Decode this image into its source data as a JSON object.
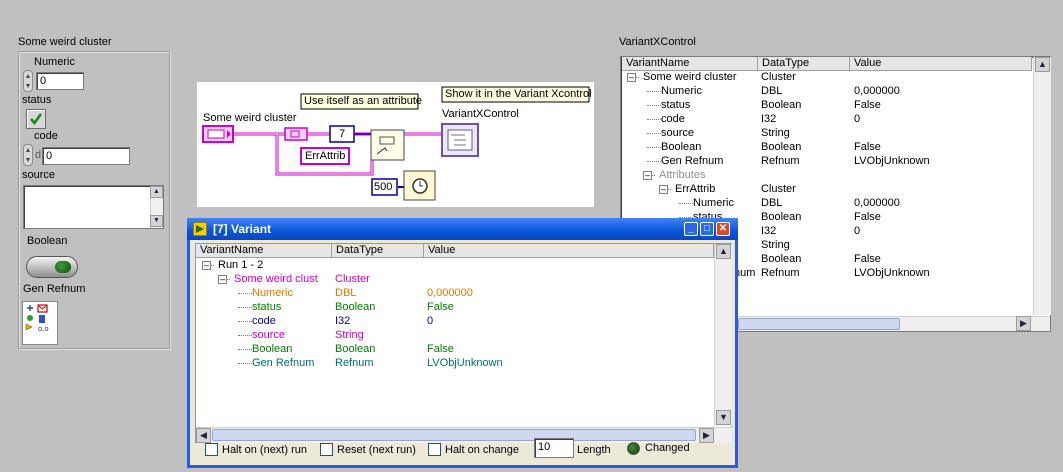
{
  "front_panel": {
    "cluster_label": "Some weird cluster",
    "numeric_label": "Numeric",
    "numeric_value": "0",
    "status_label": "status",
    "code_label": "code",
    "code_prefix": "d",
    "code_value": "0",
    "source_label": "source",
    "source_value": "",
    "boolean_label": "Boolean",
    "refnum_label": "Gen Refnum"
  },
  "block_diagram": {
    "cluster_terminal_label": "Some weird cluster",
    "attr_comment": "Use itself as an attribute",
    "show_comment": "Show it in the Variant Xcontrol",
    "xcontrol_label": "VariantXControl",
    "constant_7": "7",
    "err_attrib": "ErrAttrib",
    "constant_500": "500"
  },
  "variant_xcontrol": {
    "label": "VariantXControl",
    "columns": [
      "VariantName",
      "DataType",
      "Value"
    ],
    "rows": [
      {
        "indent": 0,
        "toggle": "-",
        "name": "Some weird cluster",
        "type": "Cluster",
        "value": ""
      },
      {
        "indent": 1,
        "toggle": "",
        "name": "Numeric",
        "type": "DBL",
        "value": "0,000000"
      },
      {
        "indent": 1,
        "toggle": "",
        "name": "status",
        "type": "Boolean",
        "value": "False"
      },
      {
        "indent": 1,
        "toggle": "",
        "name": "code",
        "type": "I32",
        "value": "0"
      },
      {
        "indent": 1,
        "toggle": "",
        "name": "source",
        "type": "String",
        "value": ""
      },
      {
        "indent": 1,
        "toggle": "",
        "name": "Boolean",
        "type": "Boolean",
        "value": "False"
      },
      {
        "indent": 1,
        "toggle": "",
        "name": "Gen Refnum",
        "type": "Refnum",
        "value": "LVObjUnknown"
      },
      {
        "indent": 1,
        "toggle": "-",
        "name": "Attributes",
        "type": "",
        "value": "",
        "muted": true
      },
      {
        "indent": 2,
        "toggle": "-",
        "name": "ErrAttrib",
        "type": "Cluster",
        "value": ""
      },
      {
        "indent": 3,
        "toggle": "",
        "name": "Numeric",
        "type": "DBL",
        "value": "0,000000"
      },
      {
        "indent": 3,
        "toggle": "",
        "name": "status",
        "type": "Boolean",
        "value": "False"
      },
      {
        "indent": 3,
        "toggle": "",
        "name": "code",
        "type": "I32",
        "value": "0"
      },
      {
        "indent": 3,
        "toggle": "",
        "name": "source",
        "type": "String",
        "value": ""
      },
      {
        "indent": 3,
        "toggle": "",
        "name": "Boolean",
        "type": "Boolean",
        "value": "False"
      },
      {
        "indent": 3,
        "toggle": "",
        "name": "Gen Refnum",
        "type": "Refnum",
        "value": "LVObjUnknown"
      }
    ]
  },
  "variant_window": {
    "title": "[7] Variant",
    "columns": [
      "VariantName",
      "DataType",
      "Value"
    ],
    "rows": [
      {
        "indent": 0,
        "toggle": "-",
        "name": "Run 1 - 2",
        "type": "",
        "value": "",
        "color": "#000000"
      },
      {
        "indent": 1,
        "toggle": "-",
        "name": "Some weird clust",
        "type": "Cluster",
        "value": "",
        "color": "#cc00cc"
      },
      {
        "indent": 2,
        "toggle": "",
        "name": "Numeric",
        "type": "DBL",
        "value": "0,000000",
        "color": "#e07800"
      },
      {
        "indent": 2,
        "toggle": "",
        "name": "status",
        "type": "Boolean",
        "value": "False",
        "color": "#008000"
      },
      {
        "indent": 2,
        "toggle": "",
        "name": "code",
        "type": "I32",
        "value": "0",
        "color": "#0000a0"
      },
      {
        "indent": 2,
        "toggle": "",
        "name": "source",
        "type": "String",
        "value": "",
        "color": "#cc00cc"
      },
      {
        "indent": 2,
        "toggle": "",
        "name": "Boolean",
        "type": "Boolean",
        "value": "False",
        "color": "#008000"
      },
      {
        "indent": 2,
        "toggle": "",
        "name": "Gen Refnum",
        "type": "Refnum",
        "value": "LVObjUnknown",
        "color": "#007070"
      }
    ],
    "halt_next_run_label": "Halt on (next) run",
    "reset_next_run_label": "Reset (next run)",
    "halt_on_change_label": "Halt on change",
    "length_value": "10",
    "length_label": "Length",
    "changed_label": "Changed"
  },
  "colors": {
    "background": "#c0c0c0",
    "titlebar": "#0a54d6",
    "cluster_wire": "#cc00cc",
    "i32_wire": "#0000a0",
    "numeric_orange": "#e07800",
    "boolean_green": "#008000",
    "refnum_teal": "#007070"
  }
}
